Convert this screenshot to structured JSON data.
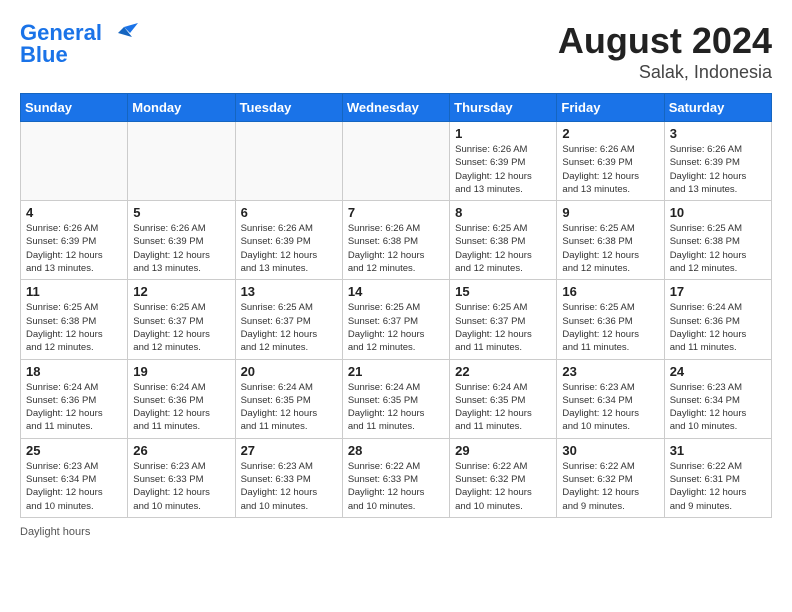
{
  "header": {
    "logo_line1": "General",
    "logo_line2": "Blue",
    "month": "August 2024",
    "location": "Salak, Indonesia"
  },
  "weekdays": [
    "Sunday",
    "Monday",
    "Tuesday",
    "Wednesday",
    "Thursday",
    "Friday",
    "Saturday"
  ],
  "weeks": [
    [
      {
        "day": "",
        "info": ""
      },
      {
        "day": "",
        "info": ""
      },
      {
        "day": "",
        "info": ""
      },
      {
        "day": "",
        "info": ""
      },
      {
        "day": "1",
        "info": "Sunrise: 6:26 AM\nSunset: 6:39 PM\nDaylight: 12 hours\nand 13 minutes."
      },
      {
        "day": "2",
        "info": "Sunrise: 6:26 AM\nSunset: 6:39 PM\nDaylight: 12 hours\nand 13 minutes."
      },
      {
        "day": "3",
        "info": "Sunrise: 6:26 AM\nSunset: 6:39 PM\nDaylight: 12 hours\nand 13 minutes."
      }
    ],
    [
      {
        "day": "4",
        "info": "Sunrise: 6:26 AM\nSunset: 6:39 PM\nDaylight: 12 hours\nand 13 minutes."
      },
      {
        "day": "5",
        "info": "Sunrise: 6:26 AM\nSunset: 6:39 PM\nDaylight: 12 hours\nand 13 minutes."
      },
      {
        "day": "6",
        "info": "Sunrise: 6:26 AM\nSunset: 6:39 PM\nDaylight: 12 hours\nand 13 minutes."
      },
      {
        "day": "7",
        "info": "Sunrise: 6:26 AM\nSunset: 6:38 PM\nDaylight: 12 hours\nand 12 minutes."
      },
      {
        "day": "8",
        "info": "Sunrise: 6:25 AM\nSunset: 6:38 PM\nDaylight: 12 hours\nand 12 minutes."
      },
      {
        "day": "9",
        "info": "Sunrise: 6:25 AM\nSunset: 6:38 PM\nDaylight: 12 hours\nand 12 minutes."
      },
      {
        "day": "10",
        "info": "Sunrise: 6:25 AM\nSunset: 6:38 PM\nDaylight: 12 hours\nand 12 minutes."
      }
    ],
    [
      {
        "day": "11",
        "info": "Sunrise: 6:25 AM\nSunset: 6:38 PM\nDaylight: 12 hours\nand 12 minutes."
      },
      {
        "day": "12",
        "info": "Sunrise: 6:25 AM\nSunset: 6:37 PM\nDaylight: 12 hours\nand 12 minutes."
      },
      {
        "day": "13",
        "info": "Sunrise: 6:25 AM\nSunset: 6:37 PM\nDaylight: 12 hours\nand 12 minutes."
      },
      {
        "day": "14",
        "info": "Sunrise: 6:25 AM\nSunset: 6:37 PM\nDaylight: 12 hours\nand 12 minutes."
      },
      {
        "day": "15",
        "info": "Sunrise: 6:25 AM\nSunset: 6:37 PM\nDaylight: 12 hours\nand 11 minutes."
      },
      {
        "day": "16",
        "info": "Sunrise: 6:25 AM\nSunset: 6:36 PM\nDaylight: 12 hours\nand 11 minutes."
      },
      {
        "day": "17",
        "info": "Sunrise: 6:24 AM\nSunset: 6:36 PM\nDaylight: 12 hours\nand 11 minutes."
      }
    ],
    [
      {
        "day": "18",
        "info": "Sunrise: 6:24 AM\nSunset: 6:36 PM\nDaylight: 12 hours\nand 11 minutes."
      },
      {
        "day": "19",
        "info": "Sunrise: 6:24 AM\nSunset: 6:36 PM\nDaylight: 12 hours\nand 11 minutes."
      },
      {
        "day": "20",
        "info": "Sunrise: 6:24 AM\nSunset: 6:35 PM\nDaylight: 12 hours\nand 11 minutes."
      },
      {
        "day": "21",
        "info": "Sunrise: 6:24 AM\nSunset: 6:35 PM\nDaylight: 12 hours\nand 11 minutes."
      },
      {
        "day": "22",
        "info": "Sunrise: 6:24 AM\nSunset: 6:35 PM\nDaylight: 12 hours\nand 11 minutes."
      },
      {
        "day": "23",
        "info": "Sunrise: 6:23 AM\nSunset: 6:34 PM\nDaylight: 12 hours\nand 10 minutes."
      },
      {
        "day": "24",
        "info": "Sunrise: 6:23 AM\nSunset: 6:34 PM\nDaylight: 12 hours\nand 10 minutes."
      }
    ],
    [
      {
        "day": "25",
        "info": "Sunrise: 6:23 AM\nSunset: 6:34 PM\nDaylight: 12 hours\nand 10 minutes."
      },
      {
        "day": "26",
        "info": "Sunrise: 6:23 AM\nSunset: 6:33 PM\nDaylight: 12 hours\nand 10 minutes."
      },
      {
        "day": "27",
        "info": "Sunrise: 6:23 AM\nSunset: 6:33 PM\nDaylight: 12 hours\nand 10 minutes."
      },
      {
        "day": "28",
        "info": "Sunrise: 6:22 AM\nSunset: 6:33 PM\nDaylight: 12 hours\nand 10 minutes."
      },
      {
        "day": "29",
        "info": "Sunrise: 6:22 AM\nSunset: 6:32 PM\nDaylight: 12 hours\nand 10 minutes."
      },
      {
        "day": "30",
        "info": "Sunrise: 6:22 AM\nSunset: 6:32 PM\nDaylight: 12 hours\nand 9 minutes."
      },
      {
        "day": "31",
        "info": "Sunrise: 6:22 AM\nSunset: 6:31 PM\nDaylight: 12 hours\nand 9 minutes."
      }
    ]
  ],
  "footer": {
    "daylight_label": "Daylight hours"
  },
  "colors": {
    "header_bg": "#1a73e8",
    "header_border": "#1565c0"
  }
}
